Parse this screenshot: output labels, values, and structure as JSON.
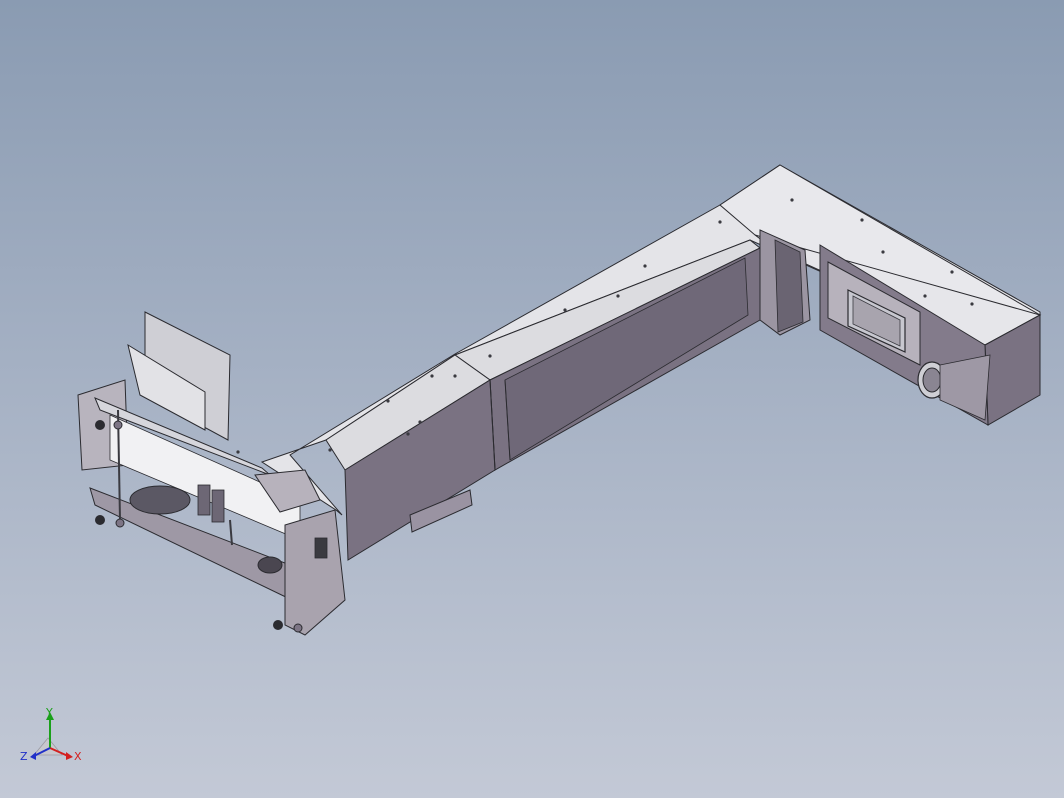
{
  "viewport": {
    "background_top": "#8a9bb2",
    "background_bottom": "#c3c9d6"
  },
  "model": {
    "colors": {
      "top_face": "#e6e6ea",
      "side_face": "#7d7585",
      "dark_face": "#5e5864",
      "edge": "#2b2b30",
      "detail": "#3a3a40"
    },
    "icons": [
      "3d-cad-model-icon"
    ]
  },
  "triad": {
    "x_label": "X",
    "y_label": "Y",
    "z_label": "Z",
    "colors": {
      "x": "#d42020",
      "y": "#1aa01a",
      "z": "#2030c8"
    }
  }
}
